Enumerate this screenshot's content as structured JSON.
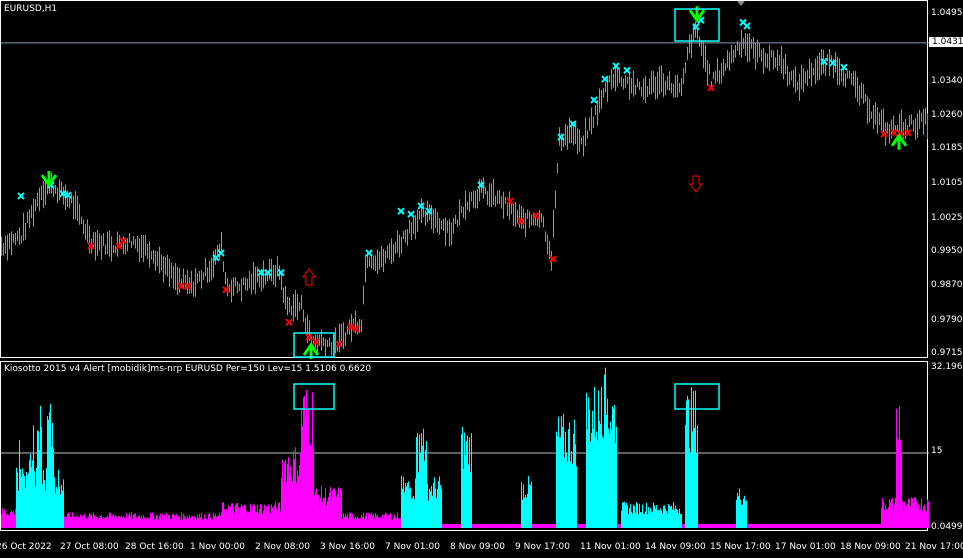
{
  "chart_data": {
    "type": "bar",
    "main": {
      "title": "EURUSD,H1",
      "yticks": [
        "1.0495",
        "1.0340",
        "1.0260",
        "1.0185",
        "1.0105",
        "1.0025",
        "0.9950",
        "0.9870",
        "0.9790",
        "0.9715"
      ],
      "ytick_values": [
        1.0495,
        1.034,
        1.026,
        1.0185,
        1.0105,
        1.0025,
        0.995,
        0.987,
        0.979,
        0.9715
      ],
      "ylim": [
        0.9715,
        1.0495
      ],
      "current_price": "1.0431",
      "current_price_value": 1.0431,
      "close_path": [
        [
          0,
          0.9965
        ],
        [
          20,
          0.9988
        ],
        [
          40,
          1.0091
        ],
        [
          50,
          1.0103
        ],
        [
          70,
          1.0068
        ],
        [
          90,
          0.9977
        ],
        [
          110,
          0.9965
        ],
        [
          130,
          0.9977
        ],
        [
          150,
          0.9954
        ],
        [
          175,
          0.9885
        ],
        [
          190,
          0.9873
        ],
        [
          210,
          0.9919
        ],
        [
          220,
          0.9965
        ],
        [
          225,
          0.9873
        ],
        [
          240,
          0.9873
        ],
        [
          260,
          0.9896
        ],
        [
          278,
          0.9908
        ],
        [
          285,
          0.9827
        ],
        [
          300,
          0.9827
        ],
        [
          310,
          0.9747
        ],
        [
          320,
          0.9747
        ],
        [
          335,
          0.9736
        ],
        [
          350,
          0.9782
        ],
        [
          360,
          0.9793
        ],
        [
          365,
          0.9942
        ],
        [
          380,
          0.9931
        ],
        [
          400,
          0.9977
        ],
        [
          410,
          1.0011
        ],
        [
          420,
          1.0034
        ],
        [
          430,
          1.0034
        ],
        [
          450,
          0.9999
        ],
        [
          465,
          1.0068
        ],
        [
          480,
          1.0091
        ],
        [
          500,
          1.0068
        ],
        [
          520,
          1.0022
        ],
        [
          540,
          1.0034
        ],
        [
          550,
          0.9942
        ],
        [
          558,
          1.0206
        ],
        [
          570,
          1.0229
        ],
        [
          580,
          1.0194
        ],
        [
          595,
          1.0275
        ],
        [
          610,
          1.0355
        ],
        [
          625,
          1.0344
        ],
        [
          640,
          1.0321
        ],
        [
          660,
          1.0344
        ],
        [
          680,
          1.0321
        ],
        [
          688,
          1.0424
        ],
        [
          695,
          1.0458
        ],
        [
          710,
          1.0344
        ],
        [
          720,
          1.0367
        ],
        [
          740,
          1.0435
        ],
        [
          760,
          1.0401
        ],
        [
          780,
          1.0389
        ],
        [
          795,
          1.0332
        ],
        [
          810,
          1.0367
        ],
        [
          830,
          1.0389
        ],
        [
          850,
          1.0344
        ],
        [
          870,
          1.0275
        ],
        [
          885,
          1.0229
        ],
        [
          900,
          1.024
        ],
        [
          927,
          1.0252
        ]
      ],
      "cyan_marks": [
        [
          20,
          1.008
        ],
        [
          50,
          1.0105
        ],
        [
          62,
          1.0085
        ],
        [
          67,
          1.0082
        ],
        [
          215,
          0.9938
        ],
        [
          220,
          0.9949
        ],
        [
          260,
          0.9904
        ],
        [
          267,
          0.9904
        ],
        [
          280,
          0.9904
        ],
        [
          368,
          0.9949
        ],
        [
          400,
          1.0045
        ],
        [
          410,
          1.0038
        ],
        [
          420,
          1.0057
        ],
        [
          428,
          1.0045
        ],
        [
          480,
          1.0105
        ],
        [
          560,
          1.0215
        ],
        [
          572,
          1.0245
        ],
        [
          593,
          1.03
        ],
        [
          604,
          1.0348
        ],
        [
          615,
          1.0378
        ],
        [
          626,
          1.0368
        ],
        [
          695,
          1.0468
        ],
        [
          700,
          1.0483
        ],
        [
          742,
          1.0478
        ],
        [
          746,
          1.047
        ],
        [
          823,
          1.0388
        ],
        [
          832,
          1.0385
        ],
        [
          843,
          1.0375
        ]
      ],
      "red_marks": [
        [
          90,
          0.9965
        ],
        [
          118,
          0.9965
        ],
        [
          122,
          0.9977
        ],
        [
          180,
          0.9873
        ],
        [
          187,
          0.9873
        ],
        [
          225,
          0.9865
        ],
        [
          288,
          0.979
        ],
        [
          308,
          0.9756
        ],
        [
          315,
          0.9745
        ],
        [
          338,
          0.974
        ],
        [
          350,
          0.978
        ],
        [
          355,
          0.9775
        ],
        [
          509,
          1.0068
        ],
        [
          520,
          1.0022
        ],
        [
          535,
          1.0035
        ],
        [
          552,
          0.9935
        ],
        [
          710,
          1.0328
        ],
        [
          883,
          1.0222
        ],
        [
          893,
          1.0225
        ],
        [
          900,
          1.0222
        ],
        [
          907,
          1.0225
        ]
      ],
      "green_arrows": [
        [
          48,
          1.0105,
          "down"
        ],
        [
          310,
          0.9738,
          "up"
        ],
        [
          696,
          1.0483,
          "down"
        ],
        [
          898,
          1.0218,
          "up"
        ]
      ],
      "red_arrows": [
        [
          308,
          "up"
        ],
        [
          695,
          "down"
        ]
      ]
    },
    "indicator": {
      "title": "Kiosotto 2015 v4 Alert [mobidik]ms-nrp EURUSD Per=150 Lev=15 1.5106 0.6620",
      "yticks": [
        "32.1964",
        "15",
        "0.0499",
        "0"
      ],
      "ylim": [
        0,
        32.1964
      ],
      "level": 15,
      "series": [
        {
          "name": "cyan",
          "color": "#00ffff",
          "segments": [
            [
              15,
              62,
              12
            ],
            [
              18,
              22,
              17
            ],
            [
              28,
              32,
              21
            ],
            [
              36,
              40,
              24
            ],
            [
              46,
              52,
              24
            ],
            [
              400,
              440,
              10
            ],
            [
              415,
              425,
              20
            ],
            [
              460,
              470,
              20
            ],
            [
              520,
              530,
              10
            ],
            [
              555,
              575,
              22
            ],
            [
              585,
              615,
              28
            ],
            [
              600,
              612,
              31
            ],
            [
              620,
              680,
              5
            ],
            [
              684,
              696,
              27
            ],
            [
              735,
              745,
              8
            ]
          ]
        },
        {
          "name": "magenta",
          "color": "#ff00ff",
          "segments": [
            [
              0,
              15,
              4
            ],
            [
              62,
              220,
              3
            ],
            [
              220,
              280,
              5
            ],
            [
              280,
              300,
              16
            ],
            [
              300,
              312,
              28
            ],
            [
              312,
              340,
              8
            ],
            [
              340,
              400,
              3
            ],
            [
              880,
              927,
              6
            ],
            [
              895,
              900,
              27
            ]
          ]
        }
      ]
    },
    "xticks": [
      "26 Oct 2022",
      "27 Oct 08:00",
      "28 Oct 16:00",
      "1 Nov 00:00",
      "2 Nov 08:00",
      "3 Nov 16:00",
      "7 Nov 01:00",
      "8 Nov 09:00",
      "9 Nov 17:00",
      "11 Nov 01:00",
      "14 Nov 09:00",
      "15 Nov 17:00",
      "17 Nov 01:00",
      "18 Nov 09:00",
      "21 Nov 17:00"
    ],
    "xtick_bars": [
      0,
      60,
      125,
      190,
      255,
      320,
      385,
      450,
      515,
      580,
      645,
      710,
      775,
      840,
      905
    ],
    "highlight_boxes": [
      [
        293,
        333
      ],
      [
        674,
        718
      ]
    ]
  },
  "colors": {
    "bull": "#00ff00",
    "cyan": "#00ffff",
    "red": "#ff0000",
    "magenta": "#ff00ff",
    "grid": "#c0c0c0"
  }
}
